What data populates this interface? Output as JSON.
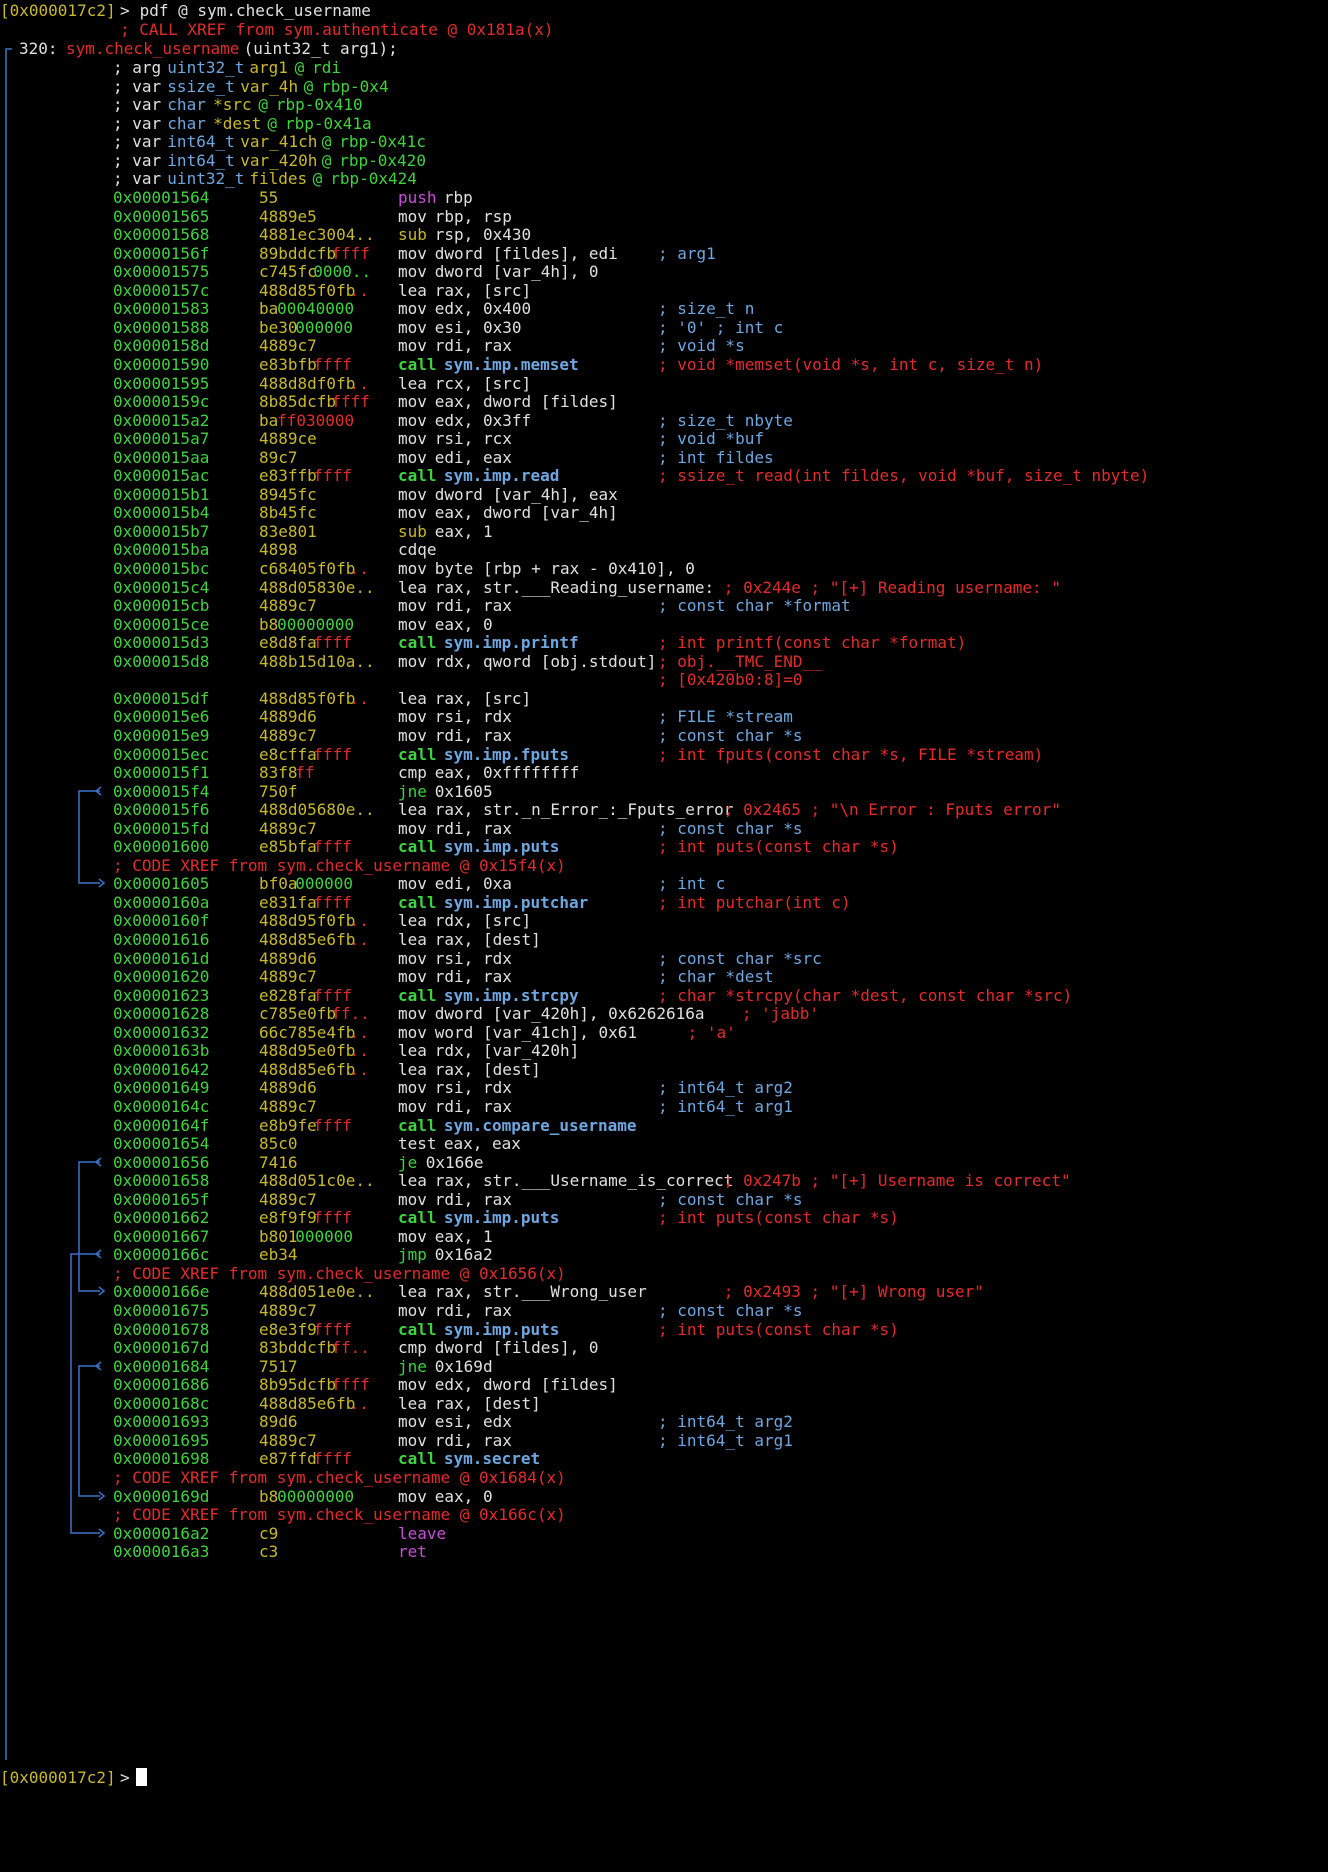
{
  "colors": {
    "green": "#3fd23f",
    "yellow": "#c8b82e",
    "red": "#e22c2c",
    "blue": "#6ea7e0",
    "white": "#e0e0e0",
    "magenta": "#c84ed8",
    "cyan": "#3a7fd8",
    "flow": "#3a73c9"
  },
  "icons": {
    "branch": "arrow-icon",
    "cursor": "caret-icon"
  },
  "prompt": {
    "address": "[0x000017c2]",
    "arrow": ">",
    "command": " pdf @ sym.check_username"
  },
  "header": {
    "xref": "; CALL XREF from sym.authenticate @ 0x181a(x)",
    "func_size": "320:",
    "func_name": "sym.check_username",
    "func_sig": " (uint32_t arg1);"
  },
  "vars": [
    {
      "kw": "; arg ",
      "type": "uint32_t",
      "name": " arg1",
      "at": " @ ",
      "loc": "rdi"
    },
    {
      "kw": "; var ",
      "type": "ssize_t",
      "name": " var_4h",
      "at": " @ ",
      "loc": "rbp-0x4"
    },
    {
      "kw": "; var ",
      "type": "char",
      "name": " *src",
      "at": " @ ",
      "loc": "rbp-0x410"
    },
    {
      "kw": "; var ",
      "type": "char",
      "name": " *dest",
      "at": " @ ",
      "loc": "rbp-0x41a"
    },
    {
      "kw": "; var ",
      "type": "int64_t",
      "name": " var_41ch",
      "at": " @ ",
      "loc": "rbp-0x41c"
    },
    {
      "kw": "; var ",
      "type": "int64_t",
      "name": " var_420h",
      "at": " @ ",
      "loc": "rbp-0x420"
    },
    {
      "kw": "; var ",
      "type": "uint32_t",
      "name": " fildes",
      "at": " @ ",
      "loc": "rbp-0x424"
    }
  ],
  "asm": [
    {
      "addr": "0x00001564",
      "b1": "55",
      "b2": "",
      "op": "push",
      "opc": "magenta",
      "args": " rbp",
      "cmt": ""
    },
    {
      "addr": "0x00001565",
      "b1": "4889e5",
      "b2": "",
      "op": "mov",
      "opc": "white",
      "args": " rbp, rsp",
      "cmt": ""
    },
    {
      "addr": "0x00001568",
      "b1": "4881ec3004..",
      "b2": "",
      "op": "sub",
      "opc": "yellow",
      "args": " rsp, 0x430",
      "cmt": ""
    },
    {
      "addr": "0x0000156f",
      "b1": "89bddcfb",
      "b2": "ffff",
      "op": "mov",
      "opc": "white",
      "args": " dword [fildes], edi",
      "cmt": "; arg1",
      "cmtc": "blue"
    },
    {
      "addr": "0x00001575",
      "b1": "c745fc",
      "b2": "0000..",
      "op": "mov",
      "opc": "white",
      "args": " dword [var_4h], 0",
      "cmt": ""
    },
    {
      "addr": "0x0000157c",
      "b1": "488d85f0fb",
      "b2": "..",
      "op": "lea",
      "opc": "white",
      "args": " rax, [src]",
      "cmt": ""
    },
    {
      "addr": "0x00001583",
      "b1": "ba",
      "b2": "00040000",
      "op": "mov",
      "opc": "white",
      "args": " edx, 0x400",
      "cmt": "; size_t n",
      "cmtc": "blue"
    },
    {
      "addr": "0x00001588",
      "b1": "be30",
      "b2": "000000",
      "op": "mov",
      "opc": "white",
      "args": " esi, 0x30",
      "cmt": "; '0' ; int c",
      "cmtc": "blue"
    },
    {
      "addr": "0x0000158d",
      "b1": "4889c7",
      "b2": "",
      "op": "mov",
      "opc": "white",
      "args": " rdi, rax",
      "cmt": "; void *s",
      "cmtc": "blue"
    },
    {
      "addr": "0x00001590",
      "b1": "e83bfb",
      "b2": "ffff",
      "op": "call",
      "opc": "green",
      "args": " sym.imp.memset",
      "argb": true,
      "cmt": "; void *memset(void *s, int c, size_t n)",
      "cmtc": "red"
    },
    {
      "addr": "0x00001595",
      "b1": "488d8df0fb",
      "b2": "..",
      "op": "lea",
      "opc": "white",
      "args": " rcx, [src]",
      "cmt": ""
    },
    {
      "addr": "0x0000159c",
      "b1": "8b85dcfb",
      "b2": "ffff",
      "op": "mov",
      "opc": "white",
      "args": " eax, dword [fildes]",
      "cmt": ""
    },
    {
      "addr": "0x000015a2",
      "b1": "ba",
      "b2": "ff030000",
      "op": "mov",
      "opc": "white",
      "args": " edx, 0x3ff",
      "cmt": "; size_t nbyte",
      "cmtc": "blue"
    },
    {
      "addr": "0x000015a7",
      "b1": "4889ce",
      "b2": "",
      "op": "mov",
      "opc": "white",
      "args": " rsi, rcx",
      "cmt": "; void *buf",
      "cmtc": "blue"
    },
    {
      "addr": "0x000015aa",
      "b1": "89c7",
      "b2": "",
      "op": "mov",
      "opc": "white",
      "args": " edi, eax",
      "cmt": "; int fildes",
      "cmtc": "blue"
    },
    {
      "addr": "0x000015ac",
      "b1": "e83ffb",
      "b2": "ffff",
      "op": "call",
      "opc": "green",
      "args": " sym.imp.read",
      "argb": true,
      "cmt": "; ssize_t read(int fildes, void *buf, size_t nbyte)",
      "cmtc": "red"
    },
    {
      "addr": "0x000015b1",
      "b1": "8945fc",
      "b2": "",
      "op": "mov",
      "opc": "white",
      "args": " dword [var_4h], eax",
      "cmt": ""
    },
    {
      "addr": "0x000015b4",
      "b1": "8b45fc",
      "b2": "",
      "op": "mov",
      "opc": "white",
      "args": " eax, dword [var_4h]",
      "cmt": ""
    },
    {
      "addr": "0x000015b7",
      "b1": "83e801",
      "b2": "",
      "op": "sub",
      "opc": "yellow",
      "args": " eax, 1",
      "cmt": ""
    },
    {
      "addr": "0x000015ba",
      "b1": "4898",
      "b2": "",
      "op": "cdqe",
      "opc": "white",
      "args": "",
      "cmt": ""
    },
    {
      "addr": "0x000015bc",
      "b1": "c68405f0fb",
      "b2": "..",
      "op": "mov",
      "opc": "white",
      "args": " byte [rbp + rax - 0x410], 0",
      "cmt": ""
    },
    {
      "addr": "0x000015c4",
      "b1": "488d05830e..",
      "b2": "",
      "op": "lea",
      "opc": "white",
      "args": " rax, str.___Reading_username:",
      "cmt": "; 0x244e ; \"[+] Reading username: \"",
      "cmtc": "red",
      "cmtcol": 36
    },
    {
      "addr": "0x000015cb",
      "b1": "4889c7",
      "b2": "",
      "op": "mov",
      "opc": "white",
      "args": " rdi, rax",
      "cmt": "; const char *format",
      "cmtc": "blue"
    },
    {
      "addr": "0x000015ce",
      "b1": "b8",
      "b2": "00000000",
      "op": "mov",
      "opc": "white",
      "args": " eax, 0",
      "cmt": ""
    },
    {
      "addr": "0x000015d3",
      "b1": "e8d8fa",
      "b2": "ffff",
      "op": "call",
      "opc": "green",
      "args": " sym.imp.printf",
      "argb": true,
      "cmt": "; int printf(const char *format)",
      "cmtc": "red"
    },
    {
      "addr": "0x000015d8",
      "b1": "488b15d10a..",
      "b2": "",
      "op": "mov",
      "opc": "white",
      "args": " rdx, qword [obj.stdout]",
      "cmt": "; obj.__TMC_END__",
      "cmtc": "red"
    },
    {
      "addr": "",
      "b1": "",
      "b2": "",
      "op": "",
      "opc": "white",
      "args": "",
      "cmt": "; [0x420b0:8]=0",
      "cmtc": "red"
    },
    {
      "addr": "0x000015df",
      "b1": "488d85f0fb",
      "b2": "..",
      "op": "lea",
      "opc": "white",
      "args": " rax, [src]",
      "cmt": ""
    },
    {
      "addr": "0x000015e6",
      "b1": "4889d6",
      "b2": "",
      "op": "mov",
      "opc": "white",
      "args": " rsi, rdx",
      "cmt": "; FILE *stream",
      "cmtc": "blue"
    },
    {
      "addr": "0x000015e9",
      "b1": "4889c7",
      "b2": "",
      "op": "mov",
      "opc": "white",
      "args": " rdi, rax",
      "cmt": "; const char *s",
      "cmtc": "blue"
    },
    {
      "addr": "0x000015ec",
      "b1": "e8cffa",
      "b2": "ffff",
      "op": "call",
      "opc": "green",
      "args": " sym.imp.fputs",
      "argb": true,
      "cmt": "; int fputs(const char *s, FILE *stream)",
      "cmtc": "red"
    },
    {
      "addr": "0x000015f1",
      "b1": "83f8",
      "b2": "ff",
      "op": "cmp",
      "opc": "white",
      "args": " eax, 0xffffffff",
      "cmt": ""
    },
    {
      "addr": "0x000015f4",
      "b1": "750f",
      "b2": "",
      "op": "jne",
      "opc": "green",
      "args": " 0x1605",
      "cmt": "",
      "arrow": "<"
    },
    {
      "addr": "0x000015f6",
      "b1": "488d05680e..",
      "b2": "",
      "op": "lea",
      "opc": "white",
      "args": " rax, str._n_Error_:_Fputs_error",
      "cmt": "; 0x2465 ; \"\\n Error : Fputs error\"",
      "cmtc": "red",
      "cmtcol": 36
    },
    {
      "addr": "0x000015fd",
      "b1": "4889c7",
      "b2": "",
      "op": "mov",
      "opc": "white",
      "args": " rdi, rax",
      "cmt": "; const char *s",
      "cmtc": "blue"
    },
    {
      "addr": "0x00001600",
      "b1": "e85bfa",
      "b2": "ffff",
      "op": "call",
      "opc": "green",
      "args": " sym.imp.puts",
      "argb": true,
      "cmt": "; int puts(const char *s)",
      "cmtc": "red"
    },
    {
      "xref": "; CODE XREF from sym.check_username @ 0x15f4(x)"
    },
    {
      "addr": "0x00001605",
      "b1": "bf0a",
      "b2": "000000",
      "op": "mov",
      "opc": "white",
      "args": " edi, 0xa",
      "cmt": "; int c",
      "cmtc": "blue",
      "arrow": ">"
    },
    {
      "addr": "0x0000160a",
      "b1": "e831fa",
      "b2": "ffff",
      "op": "call",
      "opc": "green",
      "args": " sym.imp.putchar",
      "argb": true,
      "cmt": "; int putchar(int c)",
      "cmtc": "red"
    },
    {
      "addr": "0x0000160f",
      "b1": "488d95f0fb",
      "b2": "..",
      "op": "lea",
      "opc": "white",
      "args": " rdx, [src]",
      "cmt": ""
    },
    {
      "addr": "0x00001616",
      "b1": "488d85e6fb",
      "b2": "..",
      "op": "lea",
      "opc": "white",
      "args": " rax, [dest]",
      "cmt": ""
    },
    {
      "addr": "0x0000161d",
      "b1": "4889d6",
      "b2": "",
      "op": "mov",
      "opc": "white",
      "args": " rsi, rdx",
      "cmt": "; const char *src",
      "cmtc": "blue"
    },
    {
      "addr": "0x00001620",
      "b1": "4889c7",
      "b2": "",
      "op": "mov",
      "opc": "white",
      "args": " rdi, rax",
      "cmt": "; char *dest",
      "cmtc": "blue"
    },
    {
      "addr": "0x00001623",
      "b1": "e828fa",
      "b2": "ffff",
      "op": "call",
      "opc": "green",
      "args": " sym.imp.strcpy",
      "argb": true,
      "cmt": "; char *strcpy(char *dest, const char *src)",
      "cmtc": "red"
    },
    {
      "addr": "0x00001628",
      "b1": "c785e0fb",
      "b2": "ff..",
      "op": "mov",
      "opc": "white",
      "args": " dword [var_420h], 0x6262616a",
      "cmt": "; 'jabb'",
      "cmtc": "red",
      "cmtcol": 38
    },
    {
      "addr": "0x00001632",
      "b1": "66c785e4fb",
      "b2": "..",
      "op": "mov",
      "opc": "white",
      "args": " word [var_41ch], 0x61",
      "cmt": "; 'a'",
      "cmtc": "red",
      "cmtcol": 32
    },
    {
      "addr": "0x0000163b",
      "b1": "488d95e0fb",
      "b2": "..",
      "op": "lea",
      "opc": "white",
      "args": " rdx, [var_420h]",
      "cmt": ""
    },
    {
      "addr": "0x00001642",
      "b1": "488d85e6fb",
      "b2": "..",
      "op": "lea",
      "opc": "white",
      "args": " rax, [dest]",
      "cmt": ""
    },
    {
      "addr": "0x00001649",
      "b1": "4889d6",
      "b2": "",
      "op": "mov",
      "opc": "white",
      "args": " rsi, rdx",
      "cmt": "; int64_t arg2",
      "cmtc": "blue"
    },
    {
      "addr": "0x0000164c",
      "b1": "4889c7",
      "b2": "",
      "op": "mov",
      "opc": "white",
      "args": " rdi, rax",
      "cmt": "; int64_t arg1",
      "cmtc": "blue"
    },
    {
      "addr": "0x0000164f",
      "b1": "e8b9fe",
      "b2": "ffff",
      "op": "call",
      "opc": "green",
      "args": " sym.compare_username",
      "argb": true,
      "cmt": ""
    },
    {
      "addr": "0x00001654",
      "b1": "85c0",
      "b2": "",
      "op": "test",
      "opc": "white",
      "args": " eax, eax",
      "cmt": ""
    },
    {
      "addr": "0x00001656",
      "b1": "7416",
      "b2": "",
      "op": "je",
      "opc": "green",
      "args": " 0x166e",
      "cmt": "",
      "arrow": "<"
    },
    {
      "addr": "0x00001658",
      "b1": "488d051c0e..",
      "b2": "",
      "op": "lea",
      "opc": "white",
      "args": " rax, str.___Username_is_correct",
      "cmt": "; 0x247b ; \"[+] Username is correct\"",
      "cmtc": "red",
      "cmtcol": 36
    },
    {
      "addr": "0x0000165f",
      "b1": "4889c7",
      "b2": "",
      "op": "mov",
      "opc": "white",
      "args": " rdi, rax",
      "cmt": "; const char *s",
      "cmtc": "blue"
    },
    {
      "addr": "0x00001662",
      "b1": "e8f9f9",
      "b2": "ffff",
      "op": "call",
      "opc": "green",
      "args": " sym.imp.puts",
      "argb": true,
      "cmt": "; int puts(const char *s)",
      "cmtc": "red"
    },
    {
      "addr": "0x00001667",
      "b1": "b801",
      "b2": "000000",
      "op": "mov",
      "opc": "white",
      "args": " eax, 1",
      "cmt": ""
    },
    {
      "addr": "0x0000166c",
      "b1": "eb34",
      "b2": "",
      "op": "jmp",
      "opc": "green",
      "args": " 0x16a2",
      "cmt": "",
      "arrow": "<"
    },
    {
      "xref": "; CODE XREF from sym.check_username @ 0x1656(x)"
    },
    {
      "addr": "0x0000166e",
      "b1": "488d051e0e..",
      "b2": "",
      "op": "lea",
      "opc": "white",
      "args": " rax, str.___Wrong_user",
      "cmt": "; 0x2493 ; \"[+] Wrong user\"",
      "cmtc": "red",
      "cmtcol": 36
    },
    {
      "addr": "0x00001675",
      "b1": "4889c7",
      "b2": "",
      "op": "mov",
      "opc": "white",
      "args": " rdi, rax",
      "cmt": "; const char *s",
      "cmtc": "blue"
    },
    {
      "addr": "0x00001678",
      "b1": "e8e3f9",
      "b2": "ffff",
      "op": "call",
      "opc": "green",
      "args": " sym.imp.puts",
      "argb": true,
      "cmt": "; int puts(const char *s)",
      "cmtc": "red"
    },
    {
      "addr": "0x0000167d",
      "b1": "83bddcfb",
      "b2": "ff..",
      "op": "cmp",
      "opc": "white",
      "args": " dword [fildes], 0",
      "cmt": ""
    },
    {
      "addr": "0x00001684",
      "b1": "7517",
      "b2": "",
      "op": "jne",
      "opc": "green",
      "args": " 0x169d",
      "cmt": "",
      "arrow": "<"
    },
    {
      "addr": "0x00001686",
      "b1": "8b95dcfb",
      "b2": "ffff",
      "op": "mov",
      "opc": "white",
      "args": " edx, dword [fildes]",
      "cmt": ""
    },
    {
      "addr": "0x0000168c",
      "b1": "488d85e6fb",
      "b2": "..",
      "op": "lea",
      "opc": "white",
      "args": " rax, [dest]",
      "cmt": ""
    },
    {
      "addr": "0x00001693",
      "b1": "89d6",
      "b2": "",
      "op": "mov",
      "opc": "white",
      "args": " esi, edx",
      "cmt": "; int64_t arg2",
      "cmtc": "blue"
    },
    {
      "addr": "0x00001695",
      "b1": "4889c7",
      "b2": "",
      "op": "mov",
      "opc": "white",
      "args": " rdi, rax",
      "cmt": "; int64_t arg1",
      "cmtc": "blue"
    },
    {
      "addr": "0x00001698",
      "b1": "e87ffd",
      "b2": "ffff",
      "op": "call",
      "opc": "green",
      "args": " sym.secret",
      "argb": true,
      "cmt": ""
    },
    {
      "xref": "; CODE XREF from sym.check_username @ 0x1684(x)"
    },
    {
      "addr": "0x0000169d",
      "b1": "b8",
      "b2": "00000000",
      "op": "mov",
      "opc": "white",
      "args": " eax, 0",
      "cmt": "",
      "arrow": ">"
    },
    {
      "xref": "; CODE XREF from sym.check_username @ 0x166c(x)"
    },
    {
      "addr": "0x000016a2",
      "b1": "c9",
      "b2": "",
      "op": "leave",
      "opc": "magenta",
      "args": "",
      "cmt": "",
      "arrow": ">"
    },
    {
      "addr": "0x000016a3",
      "b1": "c3",
      "b2": "",
      "op": "ret",
      "opc": "magenta",
      "args": "",
      "cmt": ""
    }
  ],
  "final_prompt": {
    "address": "[0x000017c2]",
    "arrow": ">"
  }
}
